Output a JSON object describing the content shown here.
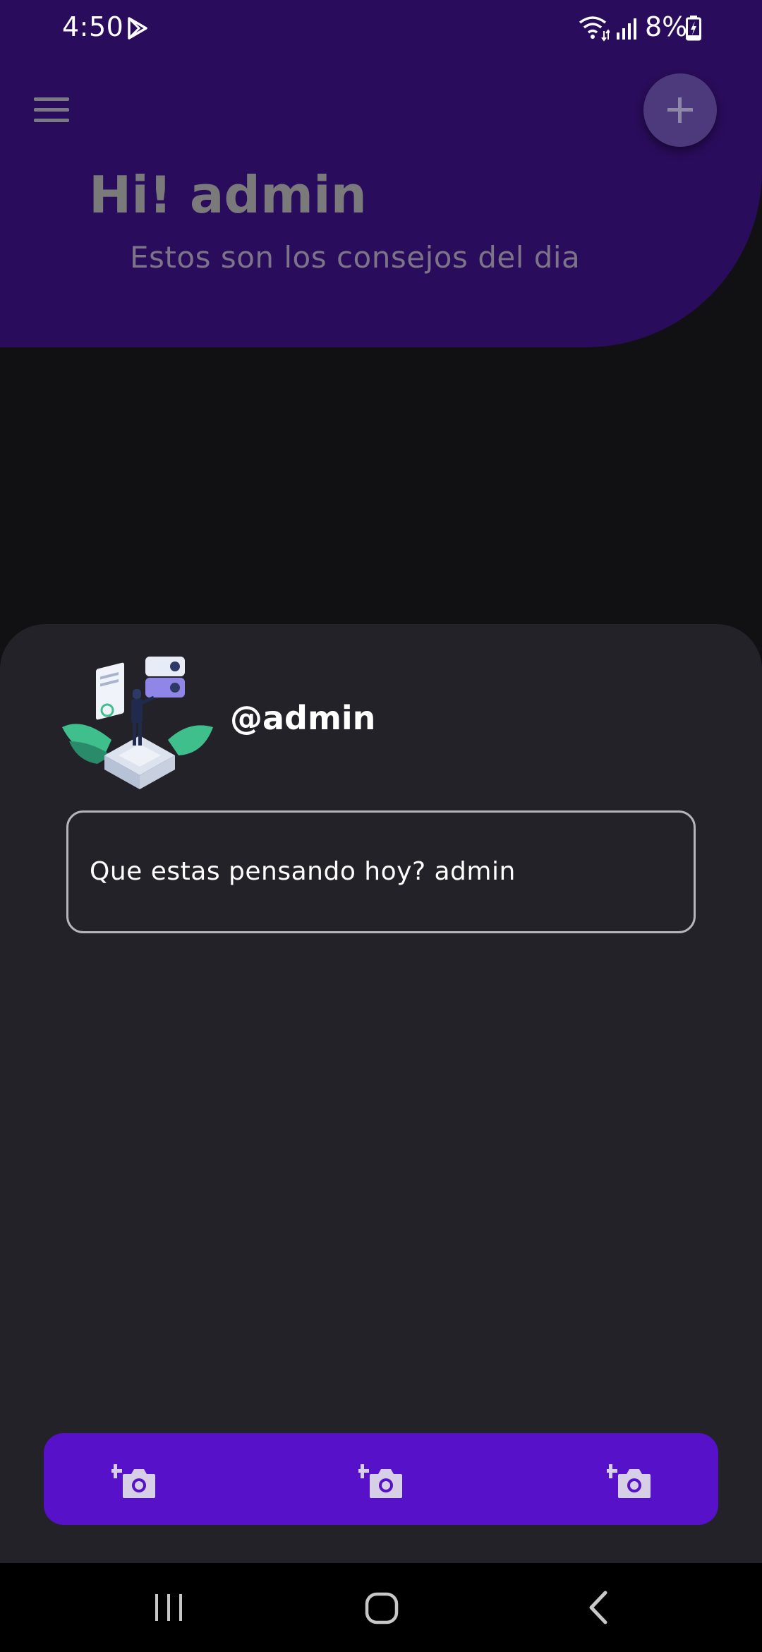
{
  "status_bar": {
    "time": "4:50",
    "battery_percent": "8%"
  },
  "header": {
    "greeting": "Hi! admin",
    "subtitle": "Estos son los consejos del dia",
    "background_color": "#2a0c5c",
    "menu_icon": "hamburger-menu-icon",
    "add_icon": "plus-icon"
  },
  "post": {
    "username": "@admin",
    "input_text": "Que estas pensando hoy? admin",
    "media_bar_color": "#5711c9",
    "media_buttons": [
      {
        "icon": "add-photo-icon"
      },
      {
        "icon": "add-photo-icon"
      },
      {
        "icon": "add-photo-icon"
      }
    ]
  },
  "nav_bar": {
    "icons": [
      "recents-icon",
      "home-icon",
      "back-icon"
    ]
  }
}
